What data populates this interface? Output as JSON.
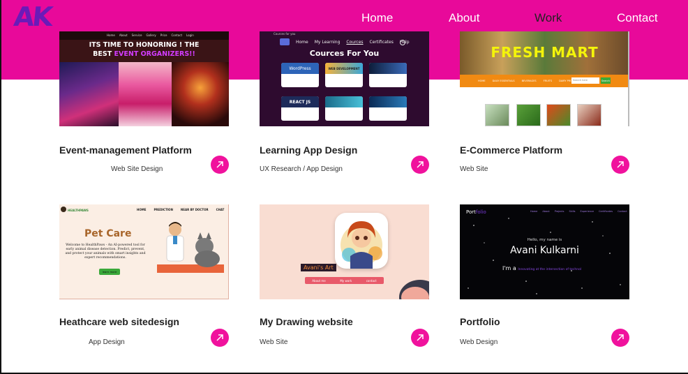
{
  "header": {
    "logo": "AK",
    "nav": [
      {
        "label": "Home",
        "active": false
      },
      {
        "label": "About",
        "active": false
      },
      {
        "label": "Work",
        "active": true
      },
      {
        "label": "Contact",
        "active": false
      }
    ]
  },
  "projects": [
    {
      "title": "Event-management Platform",
      "subtitle": "Web Site Design",
      "thumb": {
        "nav": [
          "Home",
          "About",
          "Service",
          "Gallery",
          "Price",
          "Contact",
          "Login"
        ],
        "headline_1": "ITS TIME TO HONORING ! THE",
        "headline_2a": "BEST ",
        "headline_2b": "EVENT ORGANIZERS!!"
      }
    },
    {
      "title": "Learning App Design",
      "subtitle": "UX Research / App Design",
      "thumb": {
        "tab_label": "Cources for you",
        "nav": [
          "Home",
          "My Learning",
          "Cources",
          "Certificates",
          "Help"
        ],
        "heading": "Cources For You",
        "courses": [
          "WordPress",
          "WEB DEVELOPMENT",
          "",
          "REACT JS",
          "",
          ""
        ]
      }
    },
    {
      "title": "E-Commerce Platform",
      "subtitle": "Web Site",
      "thumb": {
        "banner": "FRESH MART",
        "nav": [
          "HOME",
          "DAILY ESSENTIALS",
          "BEVERAGES",
          "FRUITS",
          "DAIRY PRODUCTS",
          "VEGITIES"
        ],
        "search_placeholder": "Search here",
        "search_button": "Search"
      }
    },
    {
      "title": "Heathcare web sitedesign",
      "subtitle": "App Design",
      "thumb": {
        "brand": "HEALTHPAWS",
        "nav": [
          "HOME",
          "PREDICTION",
          "NEAR BY DOCTOR",
          "CHAT"
        ],
        "heading": "Pet Care",
        "body": "Welcome to HealthPaws - An AI-powered tool for early animal disease detection. Predict, prevent, and protect your animals with smart insights and expert recommendations.",
        "button": "learn more"
      }
    },
    {
      "title": "My Drawing website",
      "subtitle": "Web Site",
      "thumb": {
        "label": "Avani's Art",
        "buttons": [
          "About me",
          "My work",
          "contact"
        ]
      }
    },
    {
      "title": "Portfolio",
      "subtitle": "Web Design",
      "thumb": {
        "brand_a": "Port",
        "brand_b": "folio",
        "nav": [
          "Home",
          "About",
          "Projects",
          "Skills",
          "Experience",
          "Certificates",
          "Contact"
        ],
        "hello": "Hello, my name is",
        "name": "Avani Kulkarni",
        "tagline_a": "I'm a ",
        "tagline_b": "Innovating at the intersection of technol"
      }
    }
  ],
  "colors": {
    "brand": "#e8099a",
    "logo": "#6a1bb8",
    "accent": "#f0129d"
  }
}
